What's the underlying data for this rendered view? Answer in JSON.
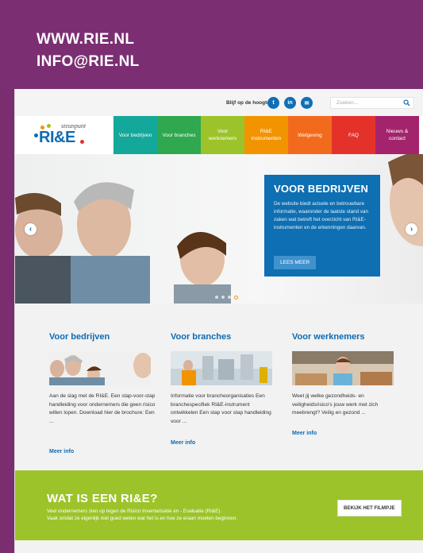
{
  "banner": {
    "line1": "WWW.RIE.NL",
    "line2": "INFO@RIE.NL",
    "color": "#7b2e72"
  },
  "topbar": {
    "follow_label": "Blijf op de hoogte",
    "social": [
      "twitter-icon",
      "linkedin-icon",
      "mail-icon"
    ],
    "social_glyphs": [
      "t",
      "in",
      "✉"
    ],
    "search_placeholder": "Zoeken..."
  },
  "logo": {
    "super": "steunpunt",
    "main": "RI&E"
  },
  "nav": {
    "tabs": [
      {
        "label": "Voor bedrijven",
        "color": "#14a89a"
      },
      {
        "label": "Voor branches",
        "color": "#2fa84f"
      },
      {
        "label": "Voor werknemers",
        "color": "#9dc32a"
      },
      {
        "label": "RI&E instrumenten",
        "color": "#f29400"
      },
      {
        "label": "Wetgeving",
        "color": "#f26b1d"
      },
      {
        "label": "FAQ",
        "color": "#e4322b"
      },
      {
        "label": "Nieuws & contact",
        "color": "#a3246c"
      }
    ]
  },
  "hero": {
    "title": "VOOR BEDRIJVEN",
    "text": "De website biedt actuele en betrouwbare informatie, waaronder de laatste stand van zaken wat betreft het overzicht van RI&E-instrumenten en de erkenningen daarvan.",
    "button": "LEES MEER"
  },
  "columns": [
    {
      "title": "Voor bedrijven",
      "text": "Aan de slag met de RI&E. Een stap-voor-stap handleiding voor ondernemers die geen risico willen lopen. Download hier de brochure: Een ...",
      "more": "Meer info"
    },
    {
      "title": "Voor branches",
      "text": "Informatie voor brancheorganisaties Een branchespecifiek RI&E-instrument ontwikkelen Een stap voor stap handleiding voor ...",
      "more": "Meer info"
    },
    {
      "title": "Voor werknemers",
      "text": "Weet jij welke gezondheids- en veiligheidsrisico's jouw werk met zich meebrengt? Veilig en gezond ...",
      "more": "Meer info"
    }
  ],
  "cta": {
    "title": "WAT IS EEN RI&E?",
    "line1": "Veel ondernemers zien op tegen de Risico Inventarisatie en - Evaluatie (RI&E).",
    "line2": "Vaak omdat ze eigenlijk niet goed weten wat het is en hoe ze eraan moeten beginnen.",
    "button": "BEKIJK HET FILMPJE"
  }
}
